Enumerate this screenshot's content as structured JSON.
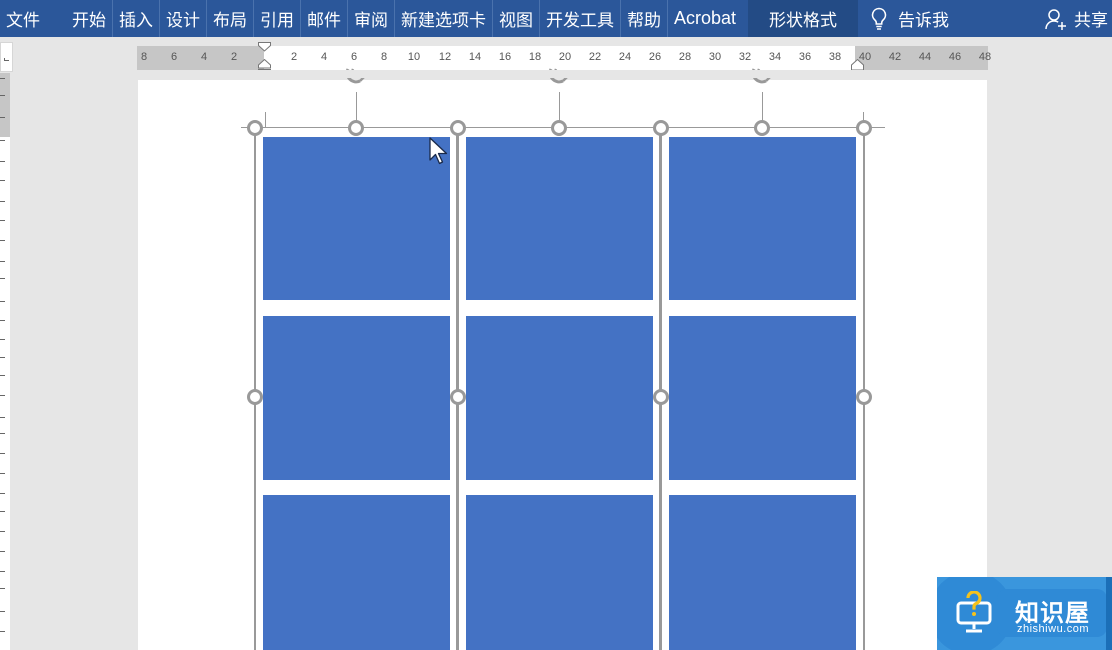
{
  "ribbon": {
    "tabs": [
      {
        "label": "文件",
        "type": "file"
      },
      {
        "label": "开始"
      },
      {
        "label": "插入"
      },
      {
        "label": "设计"
      },
      {
        "label": "布局"
      },
      {
        "label": "引用"
      },
      {
        "label": "邮件"
      },
      {
        "label": "审阅"
      },
      {
        "label": "新建选项卡"
      },
      {
        "label": "视图"
      },
      {
        "label": "开发工具"
      },
      {
        "label": "帮助"
      },
      {
        "label": "Acrobat"
      }
    ],
    "context_tab": "形状格式",
    "tell_me": {
      "label": "告诉我",
      "icon": "lightbulb-icon"
    },
    "share": {
      "label": "共享",
      "icon": "add-person-icon"
    },
    "colors": {
      "bar": "#2b579a",
      "context_tab": "#234b85"
    }
  },
  "horizontal_ruler": {
    "left_margin_ticks": [
      "8",
      "6",
      "4",
      "2"
    ],
    "body_ticks": [
      "2",
      "4",
      "6",
      "8",
      "10",
      "12",
      "14",
      "16",
      "18",
      "20",
      "22",
      "24",
      "26",
      "28",
      "30",
      "32",
      "34",
      "36",
      "38"
    ],
    "right_margin_ticks": [
      "40",
      "42",
      "44",
      "46",
      "48"
    ]
  },
  "document": {
    "shape_fill": "#4472c4",
    "grid": {
      "rows_visible": 3,
      "columns": 3
    },
    "selection": {
      "groups_selected": 3
    }
  },
  "watermark": {
    "brand": "知识屋",
    "url": "zhishiwu.com"
  }
}
